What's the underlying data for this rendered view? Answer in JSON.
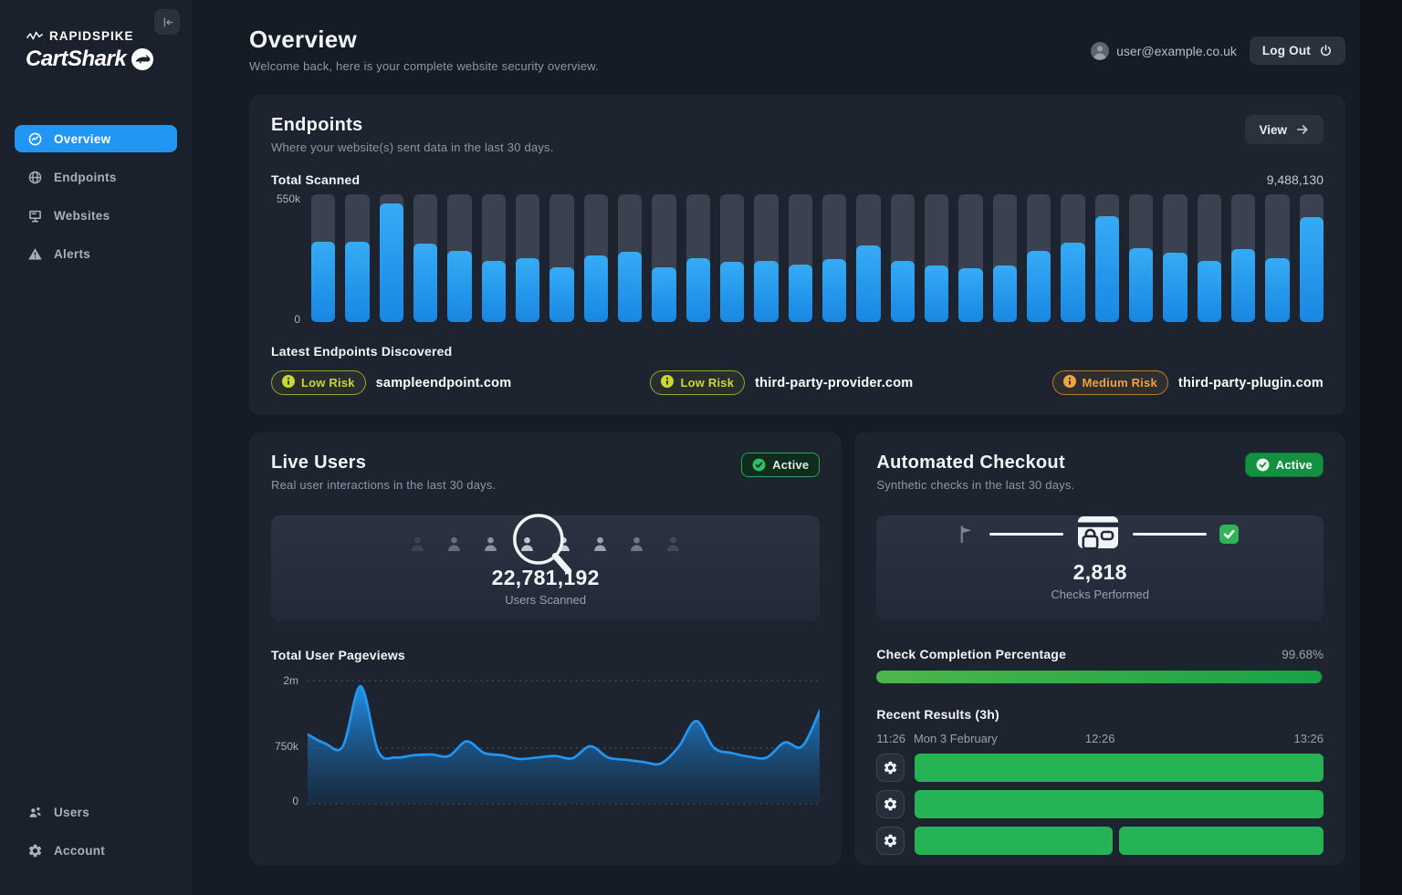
{
  "colors": {
    "accent_blue": "#2196f3",
    "success_green": "#25b355",
    "low_risk": "#c9d832",
    "medium_risk": "#eda33f"
  },
  "brand": {
    "name": "RAPIDSPIKE",
    "product": "CartShark"
  },
  "sidebar": {
    "items": [
      {
        "label": "Overview",
        "icon": "gauge-icon",
        "active": true
      },
      {
        "label": "Endpoints",
        "icon": "globe-icon",
        "active": false
      },
      {
        "label": "Websites",
        "icon": "monitor-icon",
        "active": false
      },
      {
        "label": "Alerts",
        "icon": "alert-triangle-icon",
        "active": false
      }
    ],
    "bottom_items": [
      {
        "label": "Users",
        "icon": "users-icon",
        "active": false
      },
      {
        "label": "Account",
        "icon": "gear-icon",
        "active": false
      }
    ]
  },
  "header": {
    "title": "Overview",
    "subtitle": "Welcome back, here is your complete website security overview.",
    "user_email": "user@example.co.uk",
    "logout_label": "Log Out"
  },
  "endpoints_card": {
    "title": "Endpoints",
    "subtitle": "Where your website(s) sent data in the last 30 days.",
    "view_label": "View",
    "total_scanned_label": "Total Scanned",
    "total_scanned_value": "9,488,130",
    "latest_label": "Latest Endpoints Discovered",
    "endpoints": [
      {
        "risk_label": "Low Risk",
        "level": "low",
        "domain": "sampleendpoint.com"
      },
      {
        "risk_label": "Low Risk",
        "level": "low",
        "domain": "third-party-provider.com"
      },
      {
        "risk_label": "Medium Risk",
        "level": "medium",
        "domain": "third-party-plugin.com"
      }
    ]
  },
  "live_users_card": {
    "title": "Live Users",
    "subtitle": "Real user interactions in the last 30 days.",
    "status_label": "Active",
    "users_scanned_value": "22,781,192",
    "users_scanned_label": "Users Scanned",
    "pageviews_label": "Total User Pageviews"
  },
  "checkout_card": {
    "title": "Automated Checkout",
    "subtitle": "Synthetic checks in the last 30 days.",
    "status_label": "Active",
    "checks_value": "2,818",
    "checks_label": "Checks Performed",
    "completion_label": "Check Completion Percentage",
    "completion_value": "99.68%",
    "completion_pct": 99.68,
    "recent_label": "Recent Results (3h)",
    "timeline": {
      "start_time": "11:26",
      "start_date": "Mon 3 February",
      "mid_time": "12:26",
      "end_time": "13:26"
    },
    "recent_rows": [
      {
        "segments": [
          100
        ]
      },
      {
        "segments": [
          100
        ]
      },
      {
        "segments": [
          49.2,
          50.8
        ]
      }
    ]
  },
  "chart_data": [
    {
      "id": "endpoints_total_scanned",
      "type": "bar",
      "title": "Total Scanned",
      "x_description": "last 30 days, one bar per day",
      "ylim": [
        0,
        550000
      ],
      "ytick_labels": [
        "550k",
        "0"
      ],
      "values_k": [
        347,
        347,
        512,
        336,
        308,
        264,
        275,
        237,
        286,
        303,
        237,
        275,
        259,
        264,
        248,
        270,
        330,
        264,
        242,
        231,
        242,
        308,
        341,
        457,
        319,
        297,
        264,
        314,
        275,
        451
      ]
    },
    {
      "id": "total_user_pageviews",
      "type": "area",
      "title": "Total User Pageviews",
      "x_description": "last 30 days",
      "ylim": [
        0,
        2000000
      ],
      "ytick_labels": [
        "2m",
        "750k",
        "0"
      ],
      "grid": "dotted horizontal",
      "values_k": [
        1000,
        830,
        780,
        1900,
        700,
        620,
        650,
        660,
        640,
        870,
        680,
        650,
        600,
        620,
        640,
        610,
        780,
        620,
        590,
        560,
        540,
        770,
        1250,
        750,
        680,
        630,
        620,
        850,
        780,
        1450
      ]
    }
  ]
}
